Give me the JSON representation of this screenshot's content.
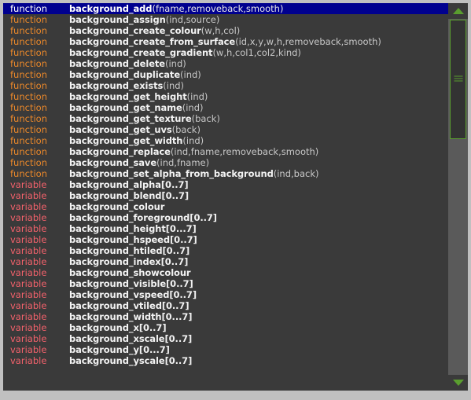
{
  "window": {
    "title": "Code autocomplete list",
    "frame_color": "#c0c0c0",
    "list_background": "#3a3a3a",
    "selection_color": "#00008f",
    "function_keyword_color": "#e8872a",
    "variable_keyword_color": "#f2616b",
    "identifier_color": "#f2f2f2",
    "arguments_color": "#c8c8c8",
    "scrollbar_accent_color": "#5a9e2f"
  },
  "scrollbar": {
    "up_arrow_icon": "triangle-up-icon",
    "down_arrow_icon": "triangle-down-icon",
    "thumb_grip_icon": "grip-lines-icon"
  },
  "list": {
    "selected_index": 0,
    "rows": [
      {
        "kind": "function",
        "name": "background_add",
        "args": "(fname,removeback,smooth)"
      },
      {
        "kind": "function",
        "name": "background_assign",
        "args": "(ind,source)"
      },
      {
        "kind": "function",
        "name": "background_create_colour",
        "args": "(w,h,col)"
      },
      {
        "kind": "function",
        "name": "background_create_from_surface",
        "args": "(id,x,y,w,h,removeback,smooth)"
      },
      {
        "kind": "function",
        "name": "background_create_gradient",
        "args": "(w,h,col1,col2,kind)"
      },
      {
        "kind": "function",
        "name": "background_delete",
        "args": "(ind)"
      },
      {
        "kind": "function",
        "name": "background_duplicate",
        "args": "(ind)"
      },
      {
        "kind": "function",
        "name": "background_exists",
        "args": "(ind)"
      },
      {
        "kind": "function",
        "name": "background_get_height",
        "args": "(ind)"
      },
      {
        "kind": "function",
        "name": "background_get_name",
        "args": "(ind)"
      },
      {
        "kind": "function",
        "name": "background_get_texture",
        "args": "(back)"
      },
      {
        "kind": "function",
        "name": "background_get_uvs",
        "args": "(back)"
      },
      {
        "kind": "function",
        "name": "background_get_width",
        "args": "(ind)"
      },
      {
        "kind": "function",
        "name": "background_replace",
        "args": "(ind,fname,removeback,smooth)"
      },
      {
        "kind": "function",
        "name": "background_save",
        "args": "(ind,fname)"
      },
      {
        "kind": "function",
        "name": "background_set_alpha_from_background",
        "args": "(ind,back)"
      },
      {
        "kind": "variable",
        "name": "background_alpha[0..7]",
        "args": ""
      },
      {
        "kind": "variable",
        "name": "background_blend[0..7]",
        "args": ""
      },
      {
        "kind": "variable",
        "name": "background_colour",
        "args": ""
      },
      {
        "kind": "variable",
        "name": "background_foreground[0..7]",
        "args": ""
      },
      {
        "kind": "variable",
        "name": "background_height[0...7]",
        "args": ""
      },
      {
        "kind": "variable",
        "name": "background_hspeed[0..7]",
        "args": ""
      },
      {
        "kind": "variable",
        "name": "background_htiled[0..7]",
        "args": ""
      },
      {
        "kind": "variable",
        "name": "background_index[0..7]",
        "args": ""
      },
      {
        "kind": "variable",
        "name": "background_showcolour",
        "args": ""
      },
      {
        "kind": "variable",
        "name": "background_visible[0..7]",
        "args": ""
      },
      {
        "kind": "variable",
        "name": "background_vspeed[0..7]",
        "args": ""
      },
      {
        "kind": "variable",
        "name": "background_vtiled[0..7]",
        "args": ""
      },
      {
        "kind": "variable",
        "name": "background_width[0...7]",
        "args": ""
      },
      {
        "kind": "variable",
        "name": "background_x[0..7]",
        "args": ""
      },
      {
        "kind": "variable",
        "name": "background_xscale[0..7]",
        "args": ""
      },
      {
        "kind": "variable",
        "name": "background_y[0...7]",
        "args": ""
      },
      {
        "kind": "variable",
        "name": "background_yscale[0..7]",
        "args": ""
      }
    ]
  }
}
